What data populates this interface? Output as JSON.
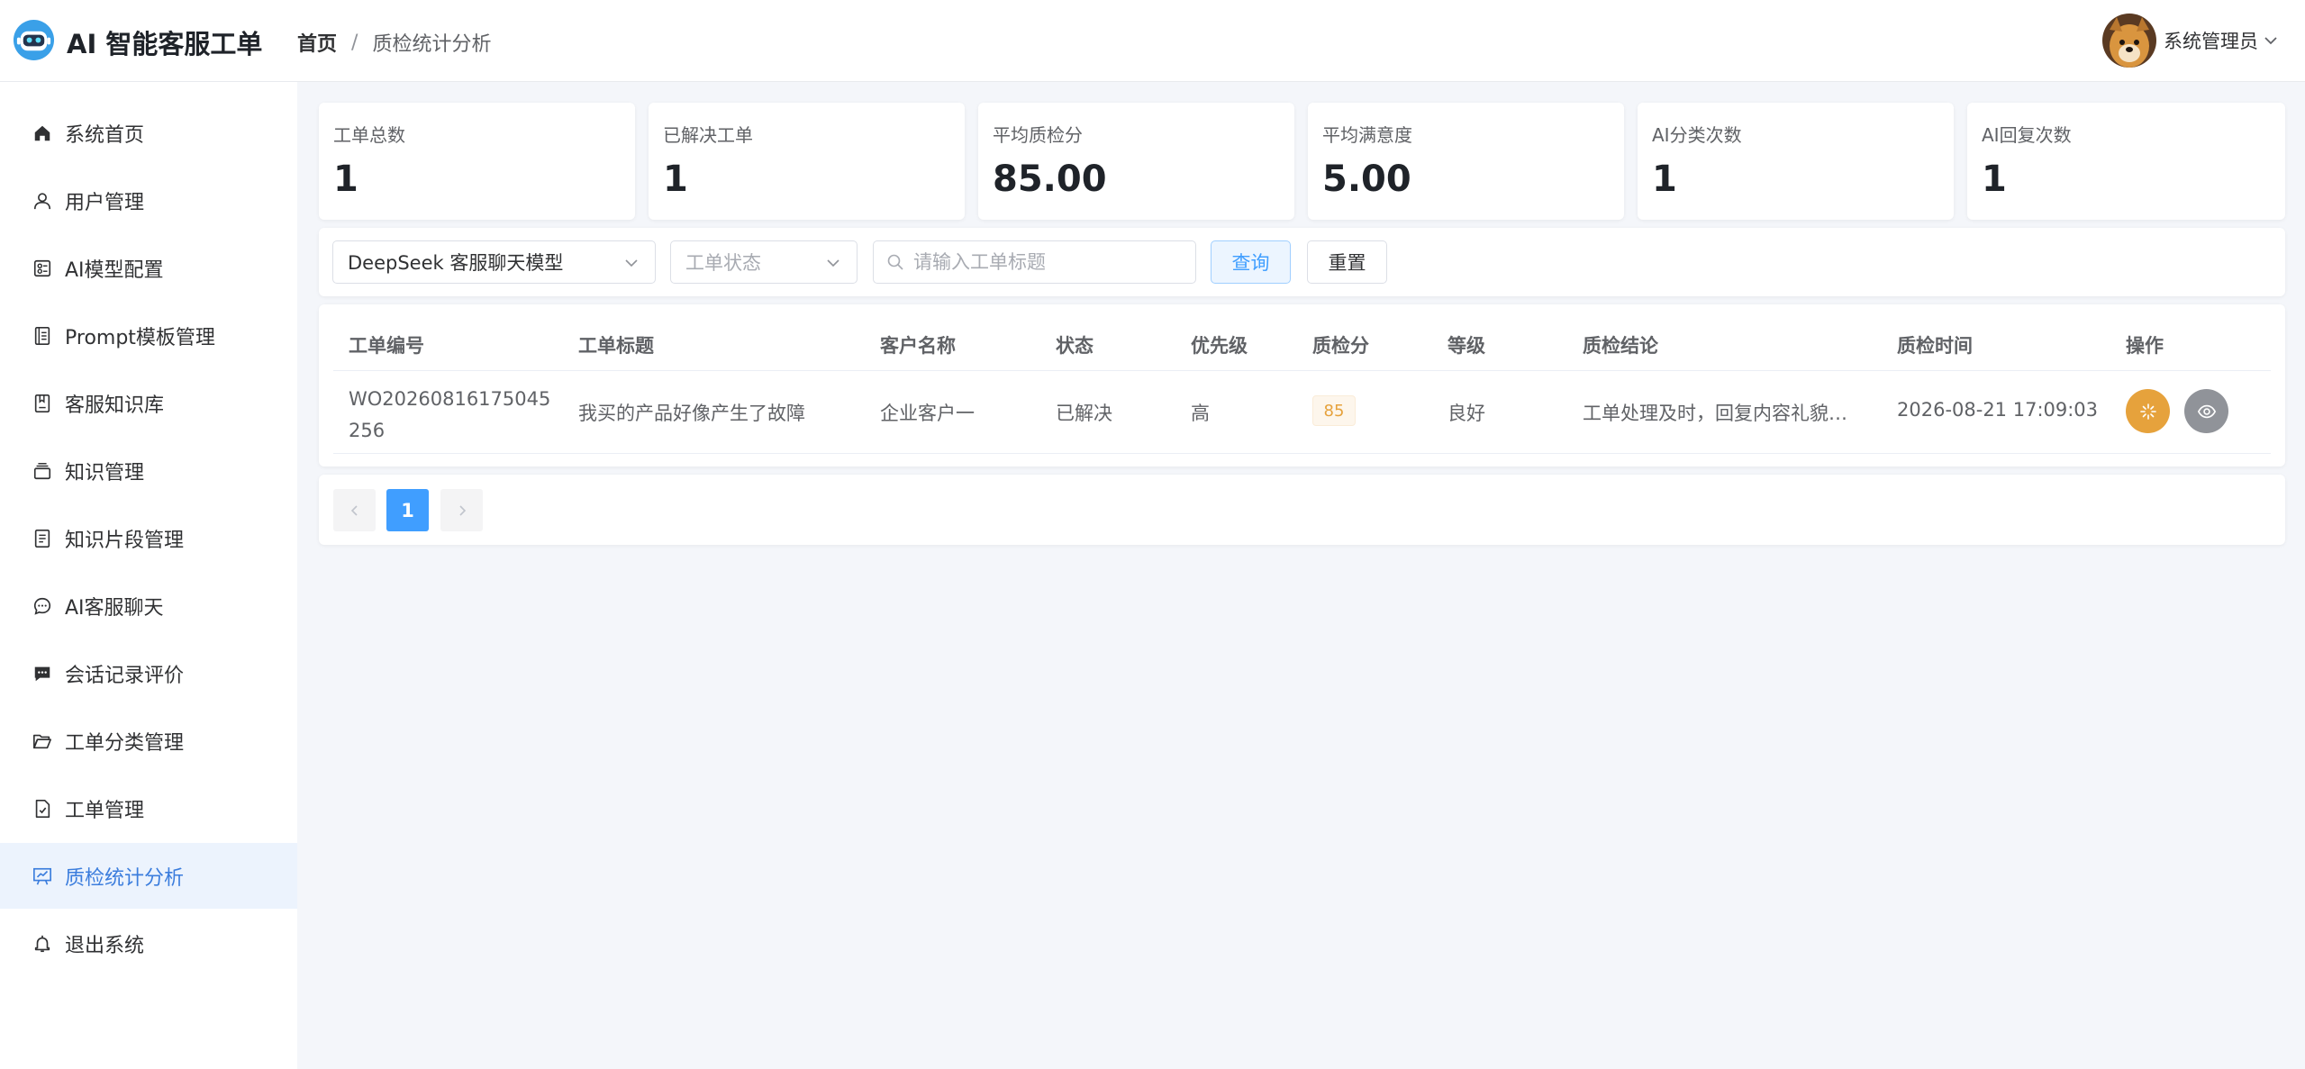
{
  "header": {
    "app_title": "AI 智能客服工单",
    "breadcrumb": [
      "首页",
      "质检统计分析"
    ],
    "username": "系统管理员"
  },
  "sidebar": {
    "items": [
      {
        "label": "系统首页",
        "icon": "home-icon"
      },
      {
        "label": "用户管理",
        "icon": "user-icon"
      },
      {
        "label": "AI模型配置",
        "icon": "model-config-icon"
      },
      {
        "label": "Prompt模板管理",
        "icon": "template-icon"
      },
      {
        "label": "客服知识库",
        "icon": "knowledge-base-icon"
      },
      {
        "label": "知识管理",
        "icon": "knowledge-icon"
      },
      {
        "label": "知识片段管理",
        "icon": "fragment-icon"
      },
      {
        "label": "AI客服聊天",
        "icon": "chat-icon"
      },
      {
        "label": "会话记录评价",
        "icon": "comment-icon"
      },
      {
        "label": "工单分类管理",
        "icon": "folder-icon"
      },
      {
        "label": "工单管理",
        "icon": "ticket-icon"
      },
      {
        "label": "质检统计分析",
        "icon": "analytics-icon",
        "active": true
      },
      {
        "label": "退出系统",
        "icon": "bell-icon"
      }
    ]
  },
  "stats": [
    {
      "label": "工单总数",
      "value": "1"
    },
    {
      "label": "已解决工单",
      "value": "1"
    },
    {
      "label": "平均质检分",
      "value": "85.00"
    },
    {
      "label": "平均满意度",
      "value": "5.00"
    },
    {
      "label": "AI分类次数",
      "value": "1"
    },
    {
      "label": "AI回复次数",
      "value": "1"
    }
  ],
  "filters": {
    "model_select": "DeepSeek 客服聊天模型",
    "status_placeholder": "工单状态",
    "search_placeholder": "请输入工单标题",
    "query_label": "查询",
    "reset_label": "重置"
  },
  "table": {
    "headers": [
      "工单编号",
      "工单标题",
      "客户名称",
      "状态",
      "优先级",
      "质检分",
      "等级",
      "质检结论",
      "质检时间",
      "操作"
    ],
    "rows": [
      {
        "id": "WO20260816175045256",
        "title": "我买的产品好像产生了故障",
        "customer": "企业客户一",
        "status": "已解决",
        "priority": "高",
        "score": "85",
        "grade": "良好",
        "conclusion": "工单处理及时，回复内容礼貌…",
        "time": "2026-08-21 17:09:03"
      }
    ]
  },
  "pagination": {
    "current": "1"
  },
  "colors": {
    "primary": "#409eff",
    "active_bg": "#ecf3fd",
    "active_text": "#3b7ddd",
    "warning": "#e6a23c",
    "info": "#909399"
  }
}
